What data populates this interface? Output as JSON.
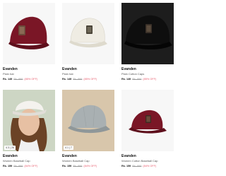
{
  "products": [
    {
      "brand": "Evanden",
      "name": "Plain hat",
      "price": "Rs. 149",
      "mrp": "Rs. 999",
      "discount": "(85% OFF)",
      "rating": ""
    },
    {
      "brand": "Evanden",
      "name": "Plain hat",
      "price": "Rs. 149",
      "mrp": "Rs. 999",
      "discount": "(85% OFF)",
      "rating": ""
    },
    {
      "brand": "Evanden",
      "name": "Plain Cotton Caps",
      "price": "Rs. 149",
      "mrp": "Rs. 999",
      "discount": "(85% OFF)",
      "rating": ""
    },
    {
      "brand": "Evanden",
      "name": "Women Baseball Cap",
      "price": "Rs. 159",
      "mrp": "Rs. 999",
      "discount": "(84% OFF)",
      "rating": "4.3 | 26"
    },
    {
      "brand": "Evanden",
      "name": "Women Baseball Cap",
      "price": "Rs. 159",
      "mrp": "Rs. 999",
      "discount": "(84% OFF)",
      "rating": "4.1 | 7"
    },
    {
      "brand": "Evanden",
      "name": "Women Cotton Baseball Cap",
      "price": "Rs. 159",
      "mrp": "Rs. 999",
      "discount": "(84% OFF)",
      "rating": ""
    }
  ],
  "colors": {
    "maroon": "#7a1626",
    "cream": "#efece3",
    "black": "#141414",
    "grey": "#a9b0b2",
    "discount": "#e85a6c"
  }
}
